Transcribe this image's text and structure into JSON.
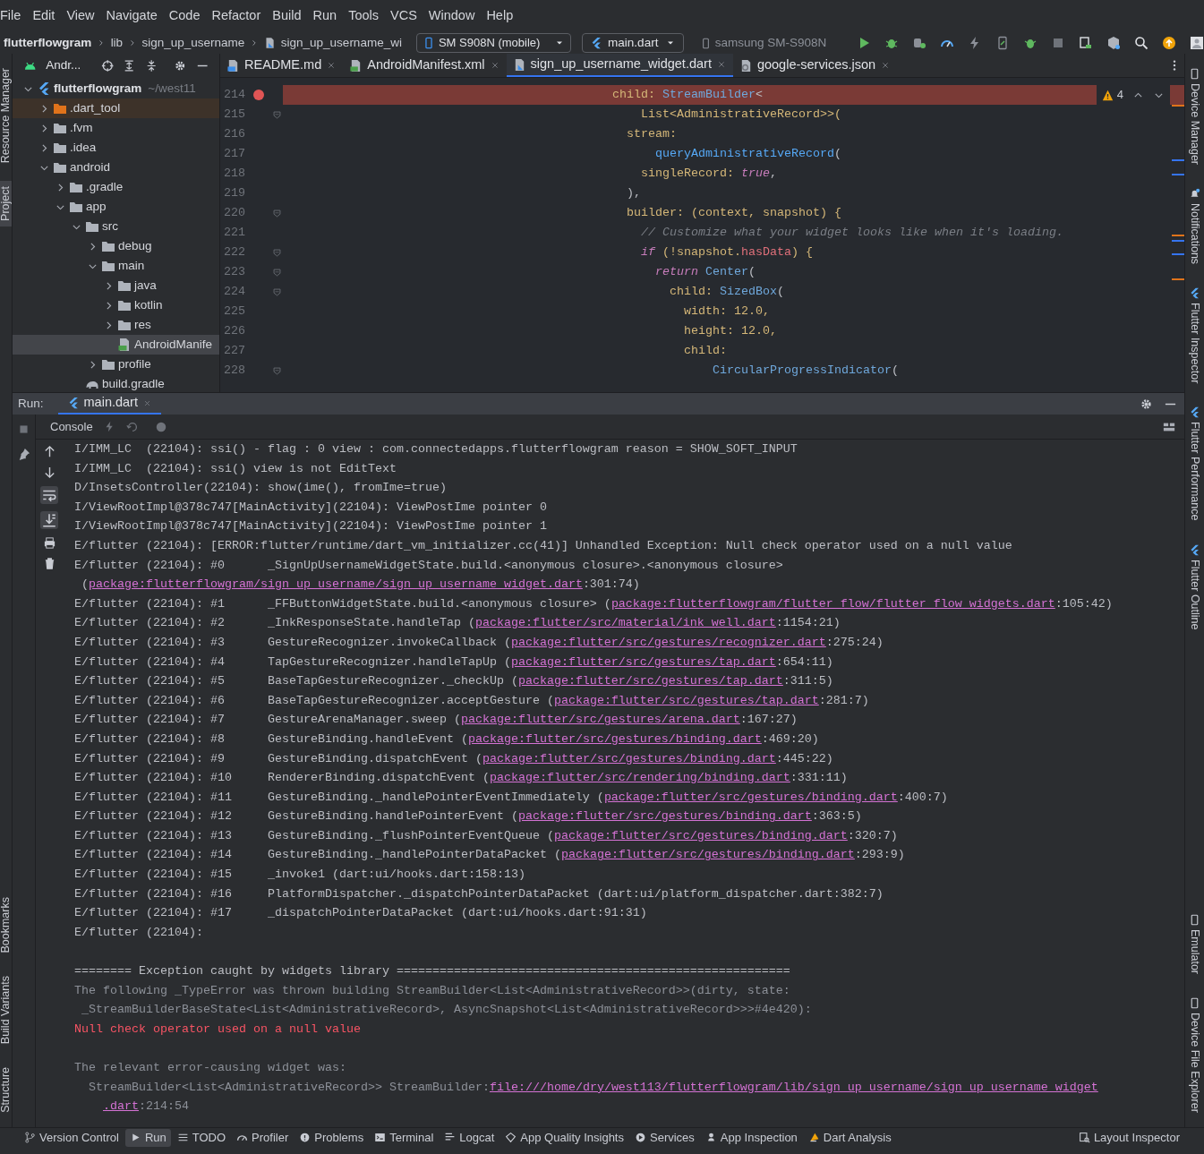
{
  "menu": [
    "File",
    "Edit",
    "View",
    "Navigate",
    "Code",
    "Refactor",
    "Build",
    "Run",
    "Tools",
    "VCS",
    "Window",
    "Help"
  ],
  "navbar": {
    "breadcrumbs": [
      {
        "label": "flutterflowgram",
        "kind": "project"
      },
      {
        "label": "lib",
        "kind": "folder"
      },
      {
        "label": "sign_up_username",
        "kind": "folder"
      },
      {
        "label": "sign_up_username_wi",
        "kind": "dart-file"
      }
    ],
    "device": "SM S908N (mobile)",
    "run_config": "main.dart",
    "target": "samsung SM-S908N"
  },
  "left_strip": {
    "top": [
      {
        "label": "Resource Manager",
        "selected": false
      },
      {
        "label": "Project",
        "selected": true
      }
    ],
    "bottom": [
      {
        "label": "Bookmarks",
        "selected": false
      },
      {
        "label": "Build Variants",
        "selected": false
      },
      {
        "label": "Structure",
        "selected": false
      }
    ]
  },
  "project_panel": {
    "title": "Andr...",
    "tree": [
      {
        "label": "flutterflowgram",
        "suffix": "~/west11",
        "kind": "flutter",
        "expanded": true,
        "selected": false,
        "children": [
          {
            "label": ".dart_tool",
            "kind": "excluded-folder",
            "expanded": false,
            "selected": false
          },
          {
            "label": ".fvm",
            "kind": "folder",
            "expanded": false,
            "selected": false
          },
          {
            "label": ".idea",
            "kind": "config-folder",
            "expanded": false,
            "selected": false
          },
          {
            "label": "android",
            "kind": "module-folder",
            "expanded": true,
            "selected": false,
            "children": [
              {
                "label": ".gradle",
                "kind": "folder",
                "expanded": false,
                "selected": false
              },
              {
                "label": "app",
                "kind": "folder",
                "expanded": true,
                "selected": false,
                "children": [
                  {
                    "label": "src",
                    "kind": "folder",
                    "expanded": true,
                    "selected": false,
                    "children": [
                      {
                        "label": "debug",
                        "kind": "folder",
                        "expanded": false,
                        "selected": false
                      },
                      {
                        "label": "main",
                        "kind": "folder",
                        "expanded": true,
                        "selected": false,
                        "children": [
                          {
                            "label": "java",
                            "kind": "folder",
                            "expanded": false,
                            "selected": false
                          },
                          {
                            "label": "kotlin",
                            "kind": "folder",
                            "expanded": false,
                            "selected": false
                          },
                          {
                            "label": "res",
                            "kind": "folder",
                            "expanded": false,
                            "selected": false
                          },
                          {
                            "label": "AndroidManife",
                            "kind": "manifest",
                            "selected": true
                          }
                        ]
                      },
                      {
                        "label": "profile",
                        "kind": "folder",
                        "expanded": false,
                        "selected": false
                      }
                    ]
                  },
                  {
                    "label": "build.gradle",
                    "kind": "gradle",
                    "selected": false
                  }
                ]
              }
            ]
          }
        ]
      }
    ]
  },
  "editor": {
    "tabs": [
      {
        "label": "README.md",
        "kind": "markdown",
        "selected": false
      },
      {
        "label": "AndroidManifest.xml",
        "kind": "manifest",
        "selected": false
      },
      {
        "label": "sign_up_username_widget.dart",
        "kind": "dart",
        "selected": true
      },
      {
        "label": "google-services.json",
        "kind": "json",
        "selected": false
      }
    ],
    "warnings": "4",
    "lines": [
      {
        "number": "214",
        "breakpoint": true,
        "fold": false,
        "code": [
          {
            "text": "child: ",
            "kind": "param"
          },
          {
            "text": "StreamBuilder",
            "kind": "class"
          },
          {
            "text": "<",
            "kind": "plain"
          }
        ]
      },
      {
        "number": "215",
        "breakpoint": false,
        "fold": true,
        "code": [
          {
            "text": "List<AdministrativeRecord>>(",
            "kind": "type"
          }
        ]
      },
      {
        "number": "216",
        "breakpoint": false,
        "fold": false,
        "code": [
          {
            "text": "stream:",
            "kind": "param"
          }
        ]
      },
      {
        "number": "217",
        "breakpoint": false,
        "fold": false,
        "code": [
          {
            "text": "queryAdministrativeRecord",
            "kind": "method"
          },
          {
            "text": "(",
            "kind": "plain"
          }
        ]
      },
      {
        "number": "218",
        "breakpoint": false,
        "fold": false,
        "code": [
          {
            "text": "singleRecord: ",
            "kind": "param"
          },
          {
            "text": "true",
            "kind": "keyword"
          },
          {
            "text": ",",
            "kind": "plain"
          }
        ]
      },
      {
        "number": "219",
        "breakpoint": false,
        "fold": false,
        "code": [
          {
            "text": "),",
            "kind": "plain"
          }
        ]
      },
      {
        "number": "220",
        "breakpoint": false,
        "fold": true,
        "code": [
          {
            "text": "builder: ",
            "kind": "param"
          },
          {
            "text": "(context, snapshot) {",
            "kind": "type"
          }
        ]
      },
      {
        "number": "221",
        "breakpoint": false,
        "fold": false,
        "code": [
          {
            "text": "// Customize what your widget looks like when it's loading.",
            "kind": "comment"
          }
        ]
      },
      {
        "number": "222",
        "breakpoint": false,
        "fold": true,
        "code": [
          {
            "text": "if",
            "kind": "keyword"
          },
          {
            "text": " (!snapshot.",
            "kind": "type"
          },
          {
            "text": "hasData",
            "kind": "field"
          },
          {
            "text": ") {",
            "kind": "type"
          }
        ]
      },
      {
        "number": "223",
        "breakpoint": false,
        "fold": true,
        "code": [
          {
            "text": "return",
            "kind": "keyword"
          },
          {
            "text": " Center",
            "kind": "class"
          },
          {
            "text": "(",
            "kind": "plain"
          }
        ]
      },
      {
        "number": "224",
        "breakpoint": false,
        "fold": true,
        "code": [
          {
            "text": "child: ",
            "kind": "param"
          },
          {
            "text": "SizedBox",
            "kind": "class"
          },
          {
            "text": "(",
            "kind": "plain"
          }
        ]
      },
      {
        "number": "225",
        "breakpoint": false,
        "fold": false,
        "code": [
          {
            "text": "width: 12.0,",
            "kind": "param"
          }
        ]
      },
      {
        "number": "226",
        "breakpoint": false,
        "fold": false,
        "code": [
          {
            "text": "height: 12.0,",
            "kind": "param"
          }
        ]
      },
      {
        "number": "227",
        "breakpoint": false,
        "fold": false,
        "code": [
          {
            "text": "child:",
            "kind": "param"
          }
        ]
      },
      {
        "number": "228",
        "breakpoint": false,
        "fold": true,
        "code": [
          {
            "text": "CircularProgressIndicator",
            "kind": "class"
          },
          {
            "text": "(",
            "kind": "plain"
          }
        ]
      }
    ]
  },
  "run_panel": {
    "label": "Run:",
    "tabs": [
      {
        "label": "main.dart",
        "selected": true
      }
    ],
    "console_tab": "Console",
    "lines": [
      {
        "kind": "normal",
        "segments": [
          {
            "text": "I/IMM_LC  (22104): ssi() - flag : 0 view : com.connectedapps.flutterflowgram reason = SHOW_SOFT_INPUT",
            "kind": "plain"
          }
        ]
      },
      {
        "kind": "normal",
        "segments": [
          {
            "text": "I/IMM_LC  (22104): ssi() view is not EditText",
            "kind": "plain"
          }
        ]
      },
      {
        "kind": "normal",
        "segments": [
          {
            "text": "D/InsetsController(22104): show(ime(), fromIme=true)",
            "kind": "plain"
          }
        ]
      },
      {
        "kind": "normal",
        "segments": [
          {
            "text": "I/ViewRootImpl@378c747[MainActivity](22104): ViewPostIme pointer 0",
            "kind": "plain"
          }
        ]
      },
      {
        "kind": "normal",
        "segments": [
          {
            "text": "I/ViewRootImpl@378c747[MainActivity](22104): ViewPostIme pointer 1",
            "kind": "plain"
          }
        ]
      },
      {
        "kind": "normal",
        "segments": [
          {
            "text": "E/flutter (22104): [ERROR:flutter/runtime/dart_vm_initializer.cc(41)] Unhandled Exception: Null check operator used on a null value",
            "kind": "plain"
          }
        ]
      },
      {
        "kind": "normal",
        "segments": [
          {
            "text": "E/flutter (22104): #0      _SignUpUsernameWidgetState.build.<anonymous closure>.<anonymous closure>",
            "kind": "plain"
          }
        ]
      },
      {
        "kind": "normal",
        "segments": [
          {
            "text": " (",
            "kind": "plain"
          },
          {
            "text": "package:flutterflowgram/sign_up_username/sign_up_username_widget.dart",
            "kind": "link"
          },
          {
            "text": ":301:74)",
            "kind": "plain"
          }
        ]
      },
      {
        "kind": "normal",
        "segments": [
          {
            "text": "E/flutter (22104): #1      _FFButtonWidgetState.build.<anonymous closure> (",
            "kind": "plain"
          },
          {
            "text": "package:flutterflowgram/flutter_flow/flutter_flow_widgets.dart",
            "kind": "link"
          },
          {
            "text": ":105:42)",
            "kind": "plain"
          }
        ]
      },
      {
        "kind": "normal",
        "segments": [
          {
            "text": "E/flutter (22104): #2      _InkResponseState.handleTap (",
            "kind": "plain"
          },
          {
            "text": "package:flutter/src/material/ink_well.dart",
            "kind": "link"
          },
          {
            "text": ":1154:21)",
            "kind": "plain"
          }
        ]
      },
      {
        "kind": "normal",
        "segments": [
          {
            "text": "E/flutter (22104): #3      GestureRecognizer.invokeCallback (",
            "kind": "plain"
          },
          {
            "text": "package:flutter/src/gestures/recognizer.dart",
            "kind": "link"
          },
          {
            "text": ":275:24)",
            "kind": "plain"
          }
        ]
      },
      {
        "kind": "normal",
        "segments": [
          {
            "text": "E/flutter (22104): #4      TapGestureRecognizer.handleTapUp (",
            "kind": "plain"
          },
          {
            "text": "package:flutter/src/gestures/tap.dart",
            "kind": "link"
          },
          {
            "text": ":654:11)",
            "kind": "plain"
          }
        ]
      },
      {
        "kind": "normal",
        "segments": [
          {
            "text": "E/flutter (22104): #5      BaseTapGestureRecognizer._checkUp (",
            "kind": "plain"
          },
          {
            "text": "package:flutter/src/gestures/tap.dart",
            "kind": "link"
          },
          {
            "text": ":311:5)",
            "kind": "plain"
          }
        ]
      },
      {
        "kind": "normal",
        "segments": [
          {
            "text": "E/flutter (22104): #6      BaseTapGestureRecognizer.acceptGesture (",
            "kind": "plain"
          },
          {
            "text": "package:flutter/src/gestures/tap.dart",
            "kind": "link"
          },
          {
            "text": ":281:7)",
            "kind": "plain"
          }
        ]
      },
      {
        "kind": "normal",
        "segments": [
          {
            "text": "E/flutter (22104): #7      GestureArenaManager.sweep (",
            "kind": "plain"
          },
          {
            "text": "package:flutter/src/gestures/arena.dart",
            "kind": "link"
          },
          {
            "text": ":167:27)",
            "kind": "plain"
          }
        ]
      },
      {
        "kind": "normal",
        "segments": [
          {
            "text": "E/flutter (22104): #8      GestureBinding.handleEvent (",
            "kind": "plain"
          },
          {
            "text": "package:flutter/src/gestures/binding.dart",
            "kind": "link"
          },
          {
            "text": ":469:20)",
            "kind": "plain"
          }
        ]
      },
      {
        "kind": "normal",
        "segments": [
          {
            "text": "E/flutter (22104): #9      GestureBinding.dispatchEvent (",
            "kind": "plain"
          },
          {
            "text": "package:flutter/src/gestures/binding.dart",
            "kind": "link"
          },
          {
            "text": ":445:22)",
            "kind": "plain"
          }
        ]
      },
      {
        "kind": "normal",
        "segments": [
          {
            "text": "E/flutter (22104): #10     RendererBinding.dispatchEvent (",
            "kind": "plain"
          },
          {
            "text": "package:flutter/src/rendering/binding.dart",
            "kind": "link"
          },
          {
            "text": ":331:11)",
            "kind": "plain"
          }
        ]
      },
      {
        "kind": "normal",
        "segments": [
          {
            "text": "E/flutter (22104): #11     GestureBinding._handlePointerEventImmediately (",
            "kind": "plain"
          },
          {
            "text": "package:flutter/src/gestures/binding.dart",
            "kind": "link"
          },
          {
            "text": ":400:7)",
            "kind": "plain"
          }
        ]
      },
      {
        "kind": "normal",
        "segments": [
          {
            "text": "E/flutter (22104): #12     GestureBinding.handlePointerEvent (",
            "kind": "plain"
          },
          {
            "text": "package:flutter/src/gestures/binding.dart",
            "kind": "link"
          },
          {
            "text": ":363:5)",
            "kind": "plain"
          }
        ]
      },
      {
        "kind": "normal",
        "segments": [
          {
            "text": "E/flutter (22104): #13     GestureBinding._flushPointerEventQueue (",
            "kind": "plain"
          },
          {
            "text": "package:flutter/src/gestures/binding.dart",
            "kind": "link"
          },
          {
            "text": ":320:7)",
            "kind": "plain"
          }
        ]
      },
      {
        "kind": "normal",
        "segments": [
          {
            "text": "E/flutter (22104): #14     GestureBinding._handlePointerDataPacket (",
            "kind": "plain"
          },
          {
            "text": "package:flutter/src/gestures/binding.dart",
            "kind": "link"
          },
          {
            "text": ":293:9)",
            "kind": "plain"
          }
        ]
      },
      {
        "kind": "normal",
        "segments": [
          {
            "text": "E/flutter (22104): #15     _invoke1 (dart:ui/hooks.dart:158:13)",
            "kind": "plain"
          }
        ]
      },
      {
        "kind": "normal",
        "segments": [
          {
            "text": "E/flutter (22104): #16     PlatformDispatcher._dispatchPointerDataPacket (dart:ui/platform_dispatcher.dart:382:7)",
            "kind": "plain"
          }
        ]
      },
      {
        "kind": "normal",
        "segments": [
          {
            "text": "E/flutter (22104): #17     _dispatchPointerDataPacket (dart:ui/hooks.dart:91:31)",
            "kind": "plain"
          }
        ]
      },
      {
        "kind": "normal",
        "segments": [
          {
            "text": "E/flutter (22104):",
            "kind": "plain"
          }
        ]
      },
      {
        "kind": "after-blank",
        "segments": [
          {
            "text": "======== Exception caught by widgets library =======================================================",
            "kind": "plain"
          }
        ]
      },
      {
        "kind": "normal",
        "segments": [
          {
            "text": "The following _TypeError was thrown building StreamBuilder<List<AdministrativeRecord>>(dirty, state:",
            "kind": "muted"
          }
        ]
      },
      {
        "kind": "normal",
        "segments": [
          {
            "text": " _StreamBuilderBaseState<List<AdministrativeRecord>, AsyncSnapshot<List<AdministrativeRecord>>>#4e420):",
            "kind": "muted"
          }
        ]
      },
      {
        "kind": "normal",
        "segments": [
          {
            "text": "Null check operator used on a null value",
            "kind": "error"
          }
        ]
      },
      {
        "kind": "after-blank",
        "segments": [
          {
            "text": "The relevant error-causing widget was:",
            "kind": "muted"
          }
        ]
      },
      {
        "kind": "normal",
        "segments": [
          {
            "text": "  StreamBuilder<List<AdministrativeRecord>> StreamBuilder:",
            "kind": "muted"
          },
          {
            "text": "file:///home/dry/west113/flutterflowgram/lib/sign_up_username/sign_up_username_widget",
            "kind": "link"
          }
        ]
      },
      {
        "kind": "continuation",
        "segments": [
          {
            "text": ".dart",
            "kind": "link"
          },
          {
            "text": ":214:54",
            "kind": "muted"
          }
        ]
      }
    ]
  },
  "right_strip": {
    "top": [
      {
        "label": "Device Manager",
        "kind": "device"
      },
      {
        "label": "Notifications",
        "kind": "bell"
      },
      {
        "label": "Flutter Inspector",
        "kind": "flutter"
      },
      {
        "label": "Flutter Performance",
        "kind": "flutter"
      },
      {
        "label": "Flutter Outline",
        "kind": "flutter"
      }
    ],
    "bottom": [
      {
        "label": "Emulator",
        "kind": "device"
      },
      {
        "label": "Device File Explorer",
        "kind": "device"
      }
    ]
  },
  "bottom_bar": {
    "left": [
      {
        "label": "Version Control",
        "kind": "vcs",
        "selected": false
      },
      {
        "label": "Run",
        "kind": "run",
        "selected": true
      },
      {
        "label": "TODO",
        "kind": "todo",
        "selected": false
      },
      {
        "label": "Profiler",
        "kind": "profiler",
        "selected": false
      },
      {
        "label": "Problems",
        "kind": "problems",
        "selected": false
      },
      {
        "label": "Terminal",
        "kind": "terminal",
        "selected": false
      },
      {
        "label": "Logcat",
        "kind": "logcat",
        "selected": false
      },
      {
        "label": "App Quality Insights",
        "kind": "insights",
        "selected": false
      },
      {
        "label": "Services",
        "kind": "services",
        "selected": false
      },
      {
        "label": "App Inspection",
        "kind": "inspection",
        "selected": false
      },
      {
        "label": "Dart Analysis",
        "kind": "dart",
        "selected": false
      }
    ],
    "right": [
      {
        "label": "Layout Inspector",
        "kind": "layout",
        "selected": false
      }
    ]
  }
}
